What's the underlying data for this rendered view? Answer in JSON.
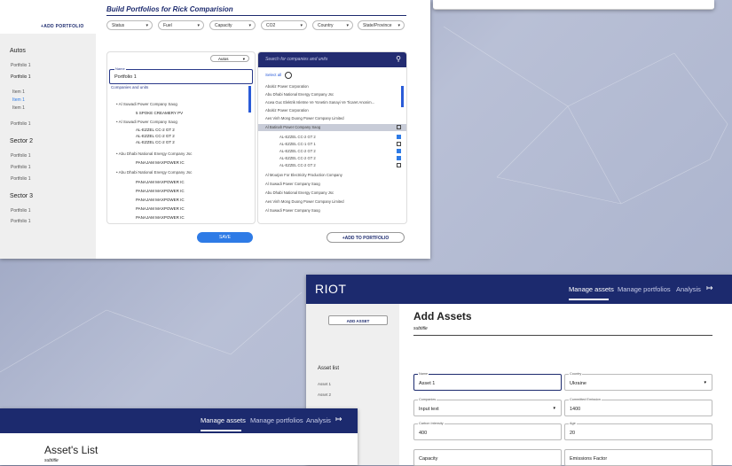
{
  "build": {
    "title": "Build Portfolios for Rick Comparision",
    "add_portfolio": "+ADD PORTFOLIO",
    "filters": [
      "Status",
      "Fuel",
      "Capacity",
      "CO2",
      "Country",
      "State/Province"
    ],
    "sidebar": {
      "sections": [
        {
          "title": "Autos",
          "items": [
            "Portfolio 1",
            "Portfolio 1",
            "Item 1",
            "Item 1",
            "Item 1",
            "Portfolio 1"
          ]
        },
        {
          "title": "Sector 2",
          "items": [
            "Portfolio 1",
            "Portfolio 1",
            "Portfolio 1"
          ]
        },
        {
          "title": "Sector 3",
          "items": [
            "Portfolio 1",
            "Portfolio 1"
          ]
        }
      ]
    },
    "left_panel": {
      "select_value": "Autos",
      "name_label": "Name",
      "name_value": "Portfolio 1",
      "companies_label": "Companies and units",
      "rows": [
        "•   Al Suwadi Power Company Saog",
        "5 SPOKE CREAMERY PV",
        "•   Al Suwadi Power Company Saog",
        "AL-EZZEL CC-2 GT 2",
        "AL-EZZEL CC-2 GT 2",
        "AL-EZZEL CC-2 GT 2",
        "•   Abu Dhabi National Energy Company Jsc",
        "PANAJAM MAXPOWER IC",
        "•   Abu Dhabi National Energy Company Jsc",
        "PANAJAM MAXPOWER IC",
        "PANAJAM MAXPOWER IC",
        "PANAJAM MAXPOWER IC",
        "PANAJAM MAXPOWER IC",
        "PANAJAM MAXPOWER IC"
      ]
    },
    "save_label": "SAVE",
    "right_panel": {
      "search_placeholder": "Search for companies and units",
      "select_all": "Select all",
      "rows": [
        "Aboitiz Power Corporation",
        "Abu Dhabi National Energy Company Jsc",
        "Acwa Guc Elektrik Isletme Ve Yonetim Sanayi Ve Ticaret Anonim...",
        "Aboitiz Power Corporation",
        "Aes Vinh Mong Duong Power Company Limited",
        "Al Batinah Power Company Saog",
        "AL-EZZEL CC-2 GT 2",
        "AL-EZZEL CC-1 GT 1",
        "AL-EZZEL CC-2 GT 2",
        "AL-EZZEL CC-2 GT 2",
        "AL-EZZEL CC-2 GT 2",
        "Al Mourjan For Electricity Production Company",
        "Al Suwadi Power Company Saog",
        "Abu Dhabi National Energy Company Jsc",
        "Aes Vinh Mong Duong Power Company Limited",
        "Al Suwadi Power Company Saog"
      ]
    },
    "add_to_portfolio": "+ADD TO PORTFOLIO"
  },
  "assets": {
    "logo": "RIOT",
    "nav": [
      "Manage assets",
      "Manage portfolios",
      "Analysis"
    ],
    "add_asset": "ADD ASSET",
    "sidebar_title": "Asset list",
    "sidebar_items": [
      "Asset 1",
      "Asset 2"
    ],
    "title": "Add Assets",
    "subtitle": "subtitle",
    "fields": {
      "name": {
        "label": "Name",
        "value": "Asset 1"
      },
      "country": {
        "label": "Country",
        "value": "Ukraine"
      },
      "companies": {
        "label": "Companies",
        "value": "Input text"
      },
      "committed": {
        "label": "Committed Emission",
        "value": "1400"
      },
      "carbon": {
        "label": "Carbon Intensity",
        "value": "400"
      },
      "age": {
        "label": "Age",
        "value": "20"
      },
      "capacity": {
        "label": "",
        "value": "Capacity"
      },
      "emissions": {
        "label": "",
        "value": "Emissions Factor"
      }
    }
  },
  "list": {
    "nav": [
      "Manage assets",
      "Manage portfolios",
      "Analysis"
    ],
    "title": "Asset's List",
    "subtitle": "subtitle"
  },
  "colors": {
    "navy": "#1c2a6e",
    "accent": "#2e7be6"
  }
}
